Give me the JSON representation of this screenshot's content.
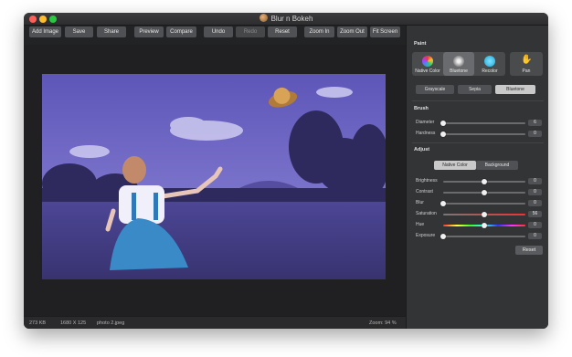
{
  "window": {
    "title": "Blur n Bokeh"
  },
  "toolbar": {
    "add_image": "Add Image",
    "save": "Save",
    "share": "Share",
    "preview": "Preview",
    "compare": "Compare",
    "undo": "Undo",
    "redo": "Redo",
    "reset": "Reset",
    "zoom_in": "Zoom In",
    "zoom_out": "Zoom Out",
    "fit_screen": "Fit Screen"
  },
  "status": {
    "size": "273 KB",
    "dimensions": "1680 X 125",
    "filename": "photo 2.jpeg",
    "zoom": "Zoom: 94 %"
  },
  "panel": {
    "paint_title": "Paint",
    "modes": [
      {
        "label": "Native Color",
        "icon": "color-wheel-icon"
      },
      {
        "label": "Bluetone",
        "icon": "bluetone-icon"
      },
      {
        "label": "Recolor",
        "icon": "recolor-icon"
      }
    ],
    "pan": {
      "label": "Pan",
      "icon": "hand-icon"
    },
    "tones": [
      "Grayscale",
      "Sepia",
      "Bluetone"
    ],
    "brush_title": "Brush",
    "brush": [
      {
        "label": "Diameter",
        "value": "6",
        "level": 0.0
      },
      {
        "label": "Hardness",
        "value": "0",
        "level": 0.0
      }
    ],
    "adjust_title": "Adjust",
    "adjust_tabs": [
      "Native Color",
      "Background"
    ],
    "adjust": [
      {
        "label": "Brightness",
        "value": "0",
        "level": 0.5
      },
      {
        "label": "Contrast",
        "value": "0",
        "level": 0.5
      },
      {
        "label": "Blur",
        "value": "0",
        "level": 0.0
      },
      {
        "label": "Saturation",
        "value": "56",
        "level": 0.5
      },
      {
        "label": "Hue",
        "value": "0",
        "level": 0.5
      },
      {
        "label": "Exposure",
        "value": "0",
        "level": 0.0
      }
    ],
    "reset": "Reset"
  },
  "colors": {
    "accent_tint": "#7b73c9",
    "window_bg": "#222325",
    "panel_bg": "#333436"
  }
}
